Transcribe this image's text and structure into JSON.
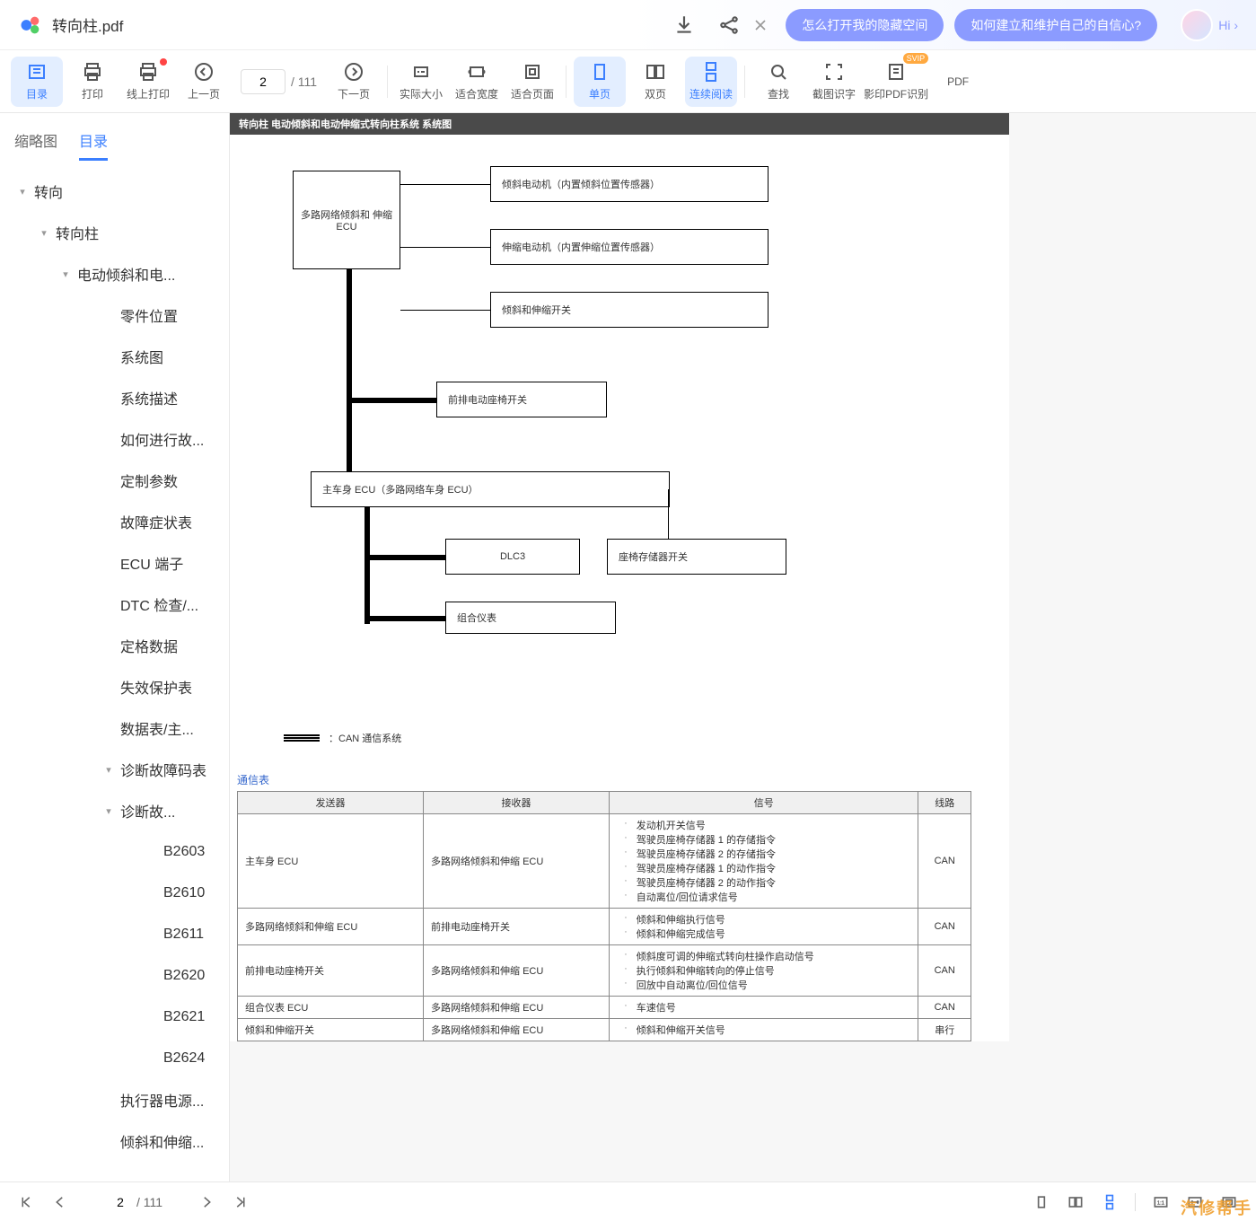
{
  "header": {
    "filename": "转向柱.pdf",
    "suggestions": [
      "怎么打开我的隐藏空间",
      "如何建立和维护自己的自信心?"
    ],
    "hi": "Hi ›"
  },
  "toolbar": {
    "items": [
      {
        "label": "目录",
        "active": true
      },
      {
        "label": "打印"
      },
      {
        "label": "线上打印",
        "badge": true
      },
      {
        "label": "上一页"
      },
      {
        "label": "下一页"
      },
      {
        "label": "实际大小"
      },
      {
        "label": "适合宽度"
      },
      {
        "label": "适合页面"
      },
      {
        "label": "单页",
        "active": true
      },
      {
        "label": "双页"
      },
      {
        "label": "连续阅读",
        "active": true
      },
      {
        "label": "查找"
      },
      {
        "label": "截图识字"
      },
      {
        "label": "影印PDF识别",
        "svip": true
      },
      {
        "label": "PDF"
      }
    ],
    "page_current": "2",
    "page_total": "/ 111"
  },
  "sidebar": {
    "tabs": [
      "缩略图",
      "目录"
    ],
    "active_tab": "目录",
    "outline": [
      {
        "lvl": 1,
        "label": "转向",
        "toggle": "▾"
      },
      {
        "lvl": 2,
        "label": "转向柱",
        "toggle": "▾"
      },
      {
        "lvl": 3,
        "label": "电动倾斜和电...",
        "toggle": "▾"
      },
      {
        "lvl": 4,
        "label": "零件位置"
      },
      {
        "lvl": 4,
        "label": "系统图"
      },
      {
        "lvl": 4,
        "label": "系统描述"
      },
      {
        "lvl": 4,
        "label": "如何进行故..."
      },
      {
        "lvl": 4,
        "label": "定制参数"
      },
      {
        "lvl": 4,
        "label": "故障症状表"
      },
      {
        "lvl": 4,
        "label": "ECU 端子"
      },
      {
        "lvl": 4,
        "label": "DTC 检查/..."
      },
      {
        "lvl": 4,
        "label": "定格数据"
      },
      {
        "lvl": 4,
        "label": "失效保护表"
      },
      {
        "lvl": 4,
        "label": "数据表/主..."
      },
      {
        "lvl": 4,
        "label": "诊断故障码表",
        "toggle": "▾"
      },
      {
        "lvl": 5,
        "label": "诊断故...",
        "toggle": "▾",
        "indent_extra": true
      },
      {
        "lvl": 6,
        "label": "B2603"
      },
      {
        "lvl": 6,
        "label": "B2610"
      },
      {
        "lvl": 6,
        "label": "B2611"
      },
      {
        "lvl": 6,
        "label": "B2620"
      },
      {
        "lvl": 6,
        "label": "B2621"
      },
      {
        "lvl": 6,
        "label": "B2624"
      },
      {
        "lvl": 4,
        "label": "执行器电源..."
      },
      {
        "lvl": 4,
        "label": "倾斜和伸缩..."
      }
    ]
  },
  "page_content": {
    "title_bar": "转向柱  电动倾斜和电动伸缩式转向柱系统  系统图",
    "diagram": {
      "boxes": {
        "ecu1": "多路网络倾斜和\n伸缩 ECU",
        "motor1": "倾斜电动机（内置倾斜位置传感器）",
        "motor2": "伸缩电动机（内置伸缩位置传感器）",
        "switch1": "倾斜和伸缩开关",
        "switch2": "前排电动座椅开关",
        "mainEcu": "主车身 ECU（多路网络车身 ECU）",
        "dlc3": "DLC3",
        "seatMem": "座椅存储器开关",
        "meter": "组合仪表"
      },
      "legend": "：CAN 通信系统"
    },
    "table_title": "通信表",
    "table": {
      "headers": [
        "发送器",
        "接收器",
        "信号",
        "线路"
      ],
      "rows": [
        {
          "sender": "主车身 ECU",
          "receiver": "多路网络倾斜和伸缩 ECU",
          "signals": [
            "发动机开关信号",
            "驾驶员座椅存储器 1 的存储指令",
            "驾驶员座椅存储器 2 的存储指令",
            "驾驶员座椅存储器 1 的动作指令",
            "驾驶员座椅存储器 2 的动作指令",
            "自动离位/回位请求信号"
          ],
          "line": "CAN"
        },
        {
          "sender": "多路网络倾斜和伸缩 ECU",
          "receiver": "前排电动座椅开关",
          "signals": [
            "倾斜和伸缩执行信号",
            "倾斜和伸缩完成信号"
          ],
          "line": "CAN"
        },
        {
          "sender": "前排电动座椅开关",
          "receiver": "多路网络倾斜和伸缩 ECU",
          "signals": [
            "倾斜度可调的伸缩式转向柱操作启动信号",
            "执行倾斜和伸缩转向的停止信号",
            "回放中自动离位/回位信号"
          ],
          "line": "CAN"
        },
        {
          "sender": "组合仪表 ECU",
          "receiver": "多路网络倾斜和伸缩 ECU",
          "signals": [
            "车速信号"
          ],
          "line": "CAN"
        },
        {
          "sender": "倾斜和伸缩开关",
          "receiver": "多路网络倾斜和伸缩 ECU",
          "signals": [
            "倾斜和伸缩开关信号"
          ],
          "line": "串行"
        }
      ]
    }
  },
  "bottom": {
    "page_current": "2",
    "page_total": "/ 111"
  },
  "watermark": "汽修帮手"
}
